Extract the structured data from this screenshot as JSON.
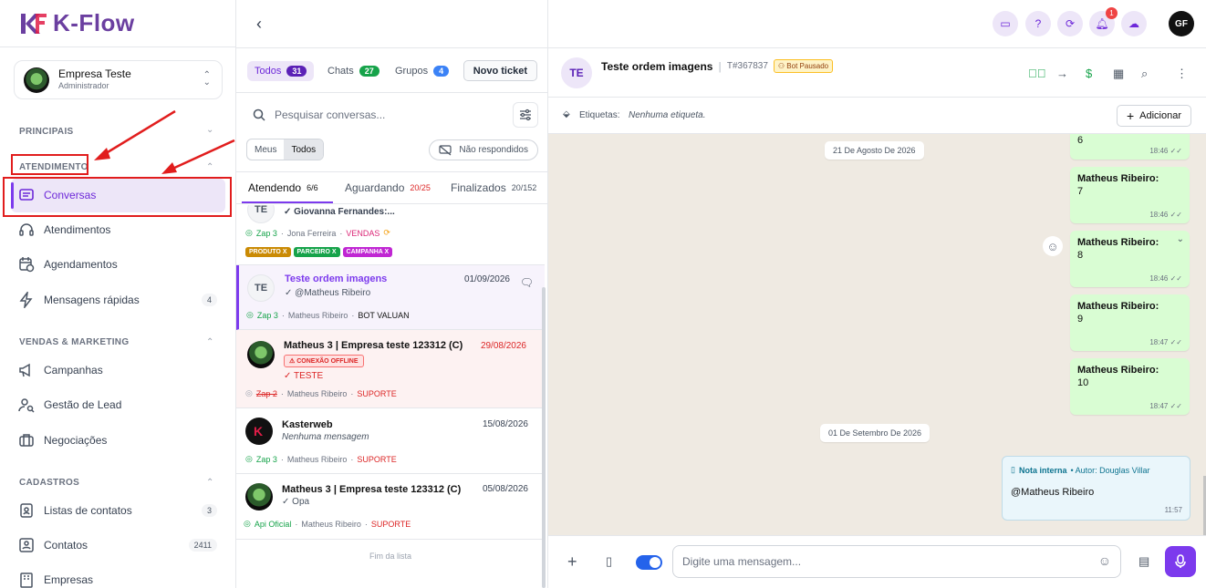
{
  "brand": {
    "name": "K-Flow"
  },
  "company": {
    "name": "Empresa Teste",
    "role": "Administrador"
  },
  "sidebar": {
    "sections": [
      {
        "label": "PRINCIPAIS"
      },
      {
        "label": "ATENDIMENTO"
      },
      {
        "label": "VENDAS & MARKETING"
      },
      {
        "label": "CADASTROS"
      }
    ],
    "items": [
      {
        "label": "Conversas",
        "icon": "chat-lines-icon"
      },
      {
        "label": "Atendimentos",
        "icon": "headset-icon"
      },
      {
        "label": "Agendamentos",
        "icon": "calendar-clock-icon"
      },
      {
        "label": "Mensagens rápidas",
        "icon": "bolt-icon",
        "badge": "4"
      },
      {
        "label": "Campanhas",
        "icon": "megaphone-icon"
      },
      {
        "label": "Gestão de Lead",
        "icon": "user-search-icon"
      },
      {
        "label": "Negociações",
        "icon": "briefcase-icon"
      },
      {
        "label": "Listas de contatos",
        "icon": "contact-list-icon",
        "badge": "3"
      },
      {
        "label": "Contatos",
        "icon": "contact-card-icon",
        "badge": "2411"
      },
      {
        "label": "Empresas",
        "icon": "building-icon"
      }
    ]
  },
  "tickets_panel": {
    "filters": [
      {
        "label": "Todos",
        "count": "31",
        "color": "#6d28d9"
      },
      {
        "label": "Chats",
        "count": "27",
        "color": "#16a34a"
      },
      {
        "label": "Grupos",
        "count": "4",
        "color": "#3b82f6"
      }
    ],
    "new_ticket": "Novo ticket",
    "search_placeholder": "Pesquisar conversas...",
    "seg": [
      "Meus",
      "Todos"
    ],
    "not_replied": "Não respondidos",
    "subtabs": [
      {
        "label": "Atendendo",
        "count": "6/6"
      },
      {
        "label": "Aguardando",
        "count": "20/25"
      },
      {
        "label": "Finalizados",
        "count": "20/152"
      }
    ],
    "tickets": [
      {
        "avatar": "TE",
        "name": "Giovanna Fernandes:...",
        "conn": "Zap 3",
        "user": "Jona Ferreira",
        "queue": "VENDAS",
        "tags": [
          "PRODUTO X",
          "PARCEIRO X",
          "CAMPANHA X"
        ]
      },
      {
        "avatar": "TE",
        "name": "Teste ordem imagens",
        "date": "01/09/2026",
        "msg": "@Matheus Ribeiro",
        "conn": "Zap 3",
        "user": "Matheus Ribeiro",
        "queue": "BOT VALUAN"
      },
      {
        "name": "Matheus 3 | Empresa teste 123312 (C)",
        "date": "29/08/2026",
        "status": "CONEXÃO OFFLINE",
        "msg": "TESTE",
        "conn": "Zap 2",
        "user": "Matheus Ribeiro",
        "queue": "SUPORTE"
      },
      {
        "name": "Kasterweb",
        "date": "15/08/2026",
        "msg": "Nenhuma mensagem",
        "conn": "Zap 3",
        "user": "Matheus Ribeiro",
        "queue": "SUPORTE"
      },
      {
        "name": "Matheus 3 | Empresa teste 123312 (C)",
        "date": "05/08/2026",
        "msg": "Opa",
        "conn": "Api Oficial",
        "user": "Matheus Ribeiro",
        "queue": "SUPORTE"
      }
    ],
    "end_label": "Fim da lista"
  },
  "topbar": {
    "notif_count": "1",
    "user_initials": "GF"
  },
  "chat": {
    "avatar": "TE",
    "title": "Teste ordem imagens",
    "ticket_id": "T#367837",
    "bot_status": "Bot Pausado",
    "labels_title": "Etiquetas:",
    "labels_value": "Nenhuma etiqueta.",
    "add_label": "Adicionar",
    "date1": "21 De Agosto De 2026",
    "date2": "01 De Setembro De 2026",
    "messages": [
      {
        "who": "",
        "text": "6",
        "time": "18:46"
      },
      {
        "who": "Matheus Ribeiro:",
        "text": "7",
        "time": "18:46"
      },
      {
        "who": "Matheus Ribeiro:",
        "text": "8",
        "time": "18:46"
      },
      {
        "who": "Matheus Ribeiro:",
        "text": "9",
        "time": "18:47"
      },
      {
        "who": "Matheus Ribeiro:",
        "text": "10",
        "time": "18:47"
      }
    ],
    "note": {
      "title": "Nota interna",
      "author": "• Autor: Douglas Villar",
      "text": "@Matheus Ribeiro",
      "time": "11:57"
    },
    "input_placeholder": "Digite uma mensagem..."
  }
}
